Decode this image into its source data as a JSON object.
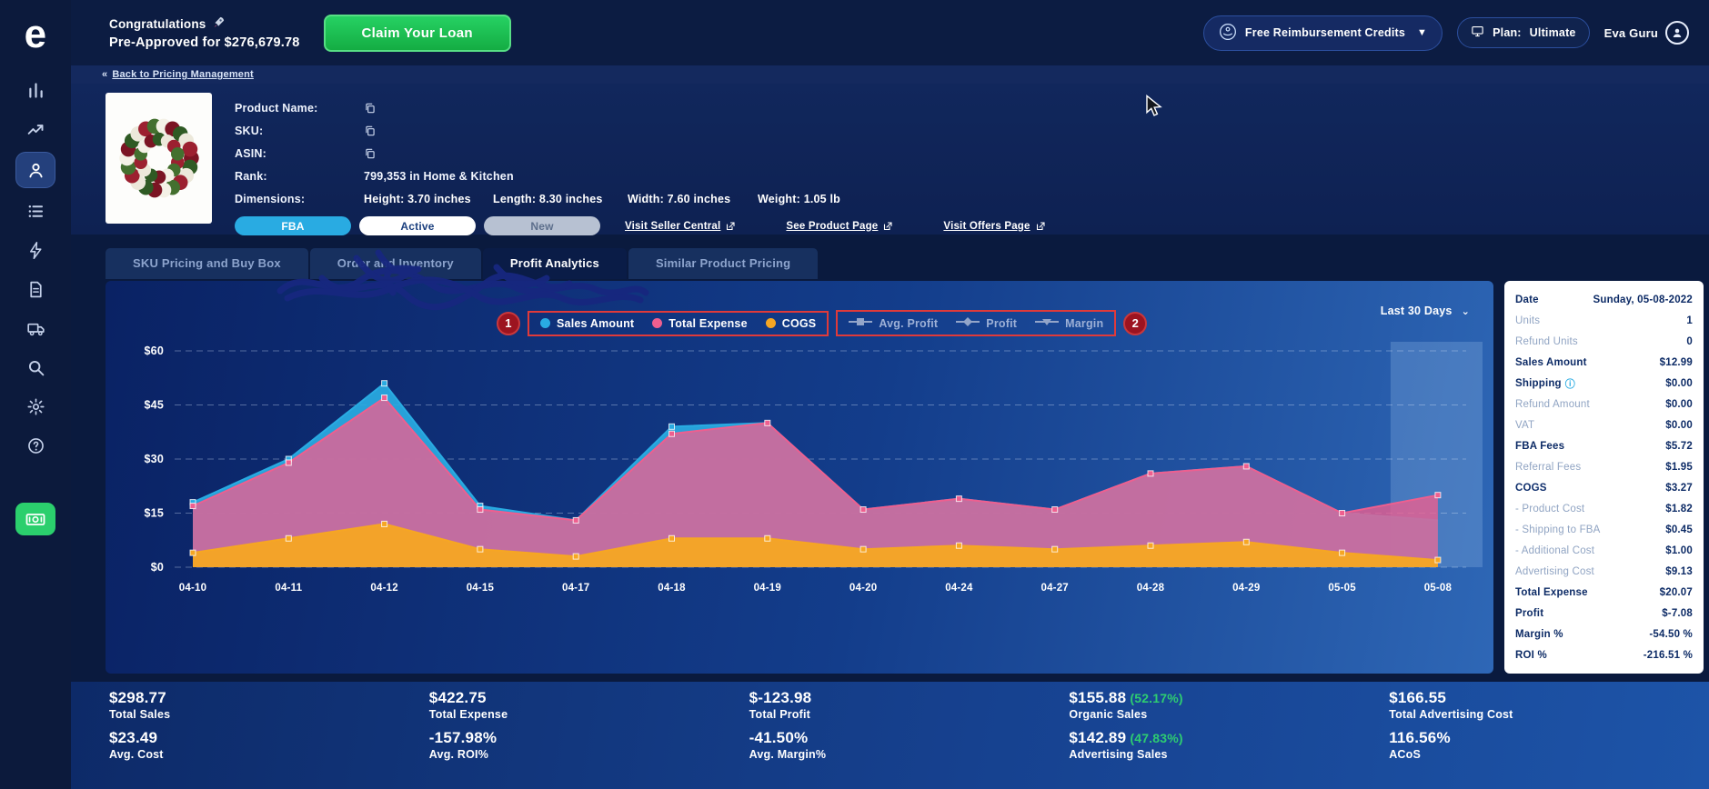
{
  "colors": {
    "accent_blue": "#29abe2",
    "expense_pink": "#ee5f8f",
    "cogs_orange": "#f6a623",
    "success_green": "#2ecc71",
    "annotation_red": "#c0182b",
    "panel_navy": "#0d2b66"
  },
  "sidebar": {
    "logo": "e",
    "items": [
      {
        "icon": "bar-chart-icon",
        "active": false
      },
      {
        "icon": "trend-up-icon",
        "active": false
      },
      {
        "icon": "user-icon",
        "active": true
      },
      {
        "icon": "list-icon",
        "active": false
      },
      {
        "icon": "bolt-icon",
        "active": false
      },
      {
        "icon": "document-icon",
        "active": false
      },
      {
        "icon": "truck-icon",
        "active": false
      },
      {
        "icon": "search-icon",
        "active": false
      },
      {
        "icon": "gear-icon",
        "active": false
      },
      {
        "icon": "help-icon",
        "active": false
      }
    ],
    "wallet_item": {
      "icon": "cash-icon"
    }
  },
  "topbar": {
    "congrats_title": "Congratulations",
    "preapproved_prefix": "Pre-Approved for",
    "preapproved_amount": "$276,679.78",
    "claim_button": "Claim Your Loan",
    "reimbursement_button": "Free Reimbursement Credits",
    "plan_label": "Plan:",
    "plan_value": "Ultimate",
    "user_name": "Eva Guru"
  },
  "back": {
    "chevron": "«",
    "label": "Back to Pricing Management"
  },
  "product": {
    "name_label": "Product Name:",
    "sku_label": "SKU:",
    "asin_label": "ASIN:",
    "rank_label": "Rank:",
    "rank_value": "799,353 in Home & Kitchen",
    "dimensions_label": "Dimensions:",
    "dims": [
      {
        "label": "Height:",
        "value": "3.70 inches"
      },
      {
        "label": "Length:",
        "value": "8.30 inches"
      },
      {
        "label": "Width:",
        "value": "7.60 inches"
      },
      {
        "label": "Weight:",
        "value": "1.05 lb"
      }
    ],
    "badges": [
      {
        "label": "FBA",
        "type": "fba"
      },
      {
        "label": "Active",
        "type": "active"
      },
      {
        "label": "New",
        "type": "new"
      }
    ],
    "links": [
      {
        "label": "Visit Seller Central"
      },
      {
        "label": "See Product Page"
      },
      {
        "label": "Visit Offers Page"
      }
    ]
  },
  "tabs": [
    {
      "label": "SKU Pricing and Buy Box",
      "active": false
    },
    {
      "label": "Order and Inventory",
      "active": false
    },
    {
      "label": "Profit Analytics",
      "active": true
    },
    {
      "label": "Similar Product Pricing",
      "active": false
    }
  ],
  "chart_data": {
    "type": "area",
    "range_selector": "Last 30 Days",
    "x": [
      "04-10",
      "04-11",
      "04-12",
      "04-15",
      "04-17",
      "04-18",
      "04-19",
      "04-20",
      "04-24",
      "04-27",
      "04-28",
      "04-29",
      "05-05",
      "05-08"
    ],
    "series": [
      {
        "name": "Sales Amount",
        "color": "#29abe2",
        "values": [
          18,
          30,
          51,
          17,
          13,
          39,
          40,
          16,
          19,
          16,
          26,
          28,
          15,
          13
        ]
      },
      {
        "name": "Total Expense",
        "color": "#ee5f8f",
        "values": [
          17,
          29,
          47,
          16,
          13,
          37,
          40,
          16,
          19,
          16,
          26,
          28,
          15,
          20
        ]
      },
      {
        "name": "COGS",
        "color": "#f6a623",
        "values": [
          4,
          8,
          12,
          5,
          3,
          8,
          8,
          5,
          6,
          5,
          6,
          7,
          4,
          2
        ]
      }
    ],
    "ylim": [
      0,
      60
    ],
    "y_ticks": [
      0,
      15,
      30,
      45,
      60
    ],
    "y_tick_labels": [
      "$0",
      "$15",
      "$30",
      "$45",
      "$60"
    ],
    "grid": "dashed horizontal",
    "legend_position": "top",
    "disabled_metrics": [
      "Avg. Profit",
      "Profit",
      "Margin"
    ],
    "highlight_last_point": true
  },
  "legend": {
    "dot_items": [
      {
        "label": "Sales Amount",
        "color": "#29abe2"
      },
      {
        "label": "Total Expense",
        "color": "#ee5f8f"
      },
      {
        "label": "COGS",
        "color": "#f6a623"
      }
    ],
    "line_items": [
      {
        "label": "Avg. Profit",
        "marker": "square"
      },
      {
        "label": "Profit",
        "marker": "diamond"
      },
      {
        "label": "Margin",
        "marker": "triangle-down"
      }
    ]
  },
  "annotations": {
    "marker1": "1",
    "marker2": "2"
  },
  "side_panel": {
    "rows": [
      {
        "label": "Date",
        "value": "Sunday, 05-08-2022",
        "bold": true
      },
      {
        "label": "Units",
        "value": "1",
        "muted": true
      },
      {
        "label": "Refund Units",
        "value": "0",
        "muted": true
      },
      {
        "label": "Sales Amount",
        "value": "$12.99",
        "bold": true
      },
      {
        "label": "Shipping",
        "value": "$0.00",
        "bold": true,
        "info": true
      },
      {
        "label": "Refund Amount",
        "value": "$0.00",
        "muted": true
      },
      {
        "label": "VAT",
        "value": "$0.00",
        "muted": true
      },
      {
        "label": "FBA Fees",
        "value": "$5.72",
        "bold": true
      },
      {
        "label": "Referral Fees",
        "value": "$1.95",
        "muted": true
      },
      {
        "label": "COGS",
        "value": "$3.27"
      },
      {
        "label": "- Product Cost",
        "value": "$1.82",
        "muted": true
      },
      {
        "label": "- Shipping to FBA",
        "value": "$0.45",
        "muted": true
      },
      {
        "label": "- Additional Cost",
        "value": "$1.00",
        "muted": true
      },
      {
        "label": "Advertising Cost",
        "value": "$9.13",
        "muted": true
      },
      {
        "label": "Total Expense",
        "value": "$20.07",
        "bold": true
      },
      {
        "label": "Profit",
        "value": "$-7.08",
        "bold": true
      },
      {
        "label": "Margin %",
        "value": "-54.50 %",
        "bold": true
      },
      {
        "label": "ROI %",
        "value": "-216.51 %",
        "bold": true
      }
    ]
  },
  "bottom_stats": {
    "row1": [
      {
        "value": "$298.77",
        "label": "Total Sales"
      },
      {
        "value": "$422.75",
        "label": "Total Expense"
      },
      {
        "value": "$-123.98",
        "label": "Total Profit"
      },
      {
        "value": "$155.88",
        "extra": "(52.17%)",
        "label": "Organic Sales"
      },
      {
        "value": "$166.55",
        "label": "Total Advertising Cost"
      }
    ],
    "row2": [
      {
        "value": "$23.49",
        "label": "Avg. Cost"
      },
      {
        "value": "-157.98%",
        "label": "Avg. ROI%"
      },
      {
        "value": "-41.50%",
        "label": "Avg. Margin%"
      },
      {
        "value": "$142.89",
        "extra": "(47.83%)",
        "label": "Advertising Sales"
      },
      {
        "value": "116.56%",
        "label": "ACoS"
      }
    ]
  }
}
